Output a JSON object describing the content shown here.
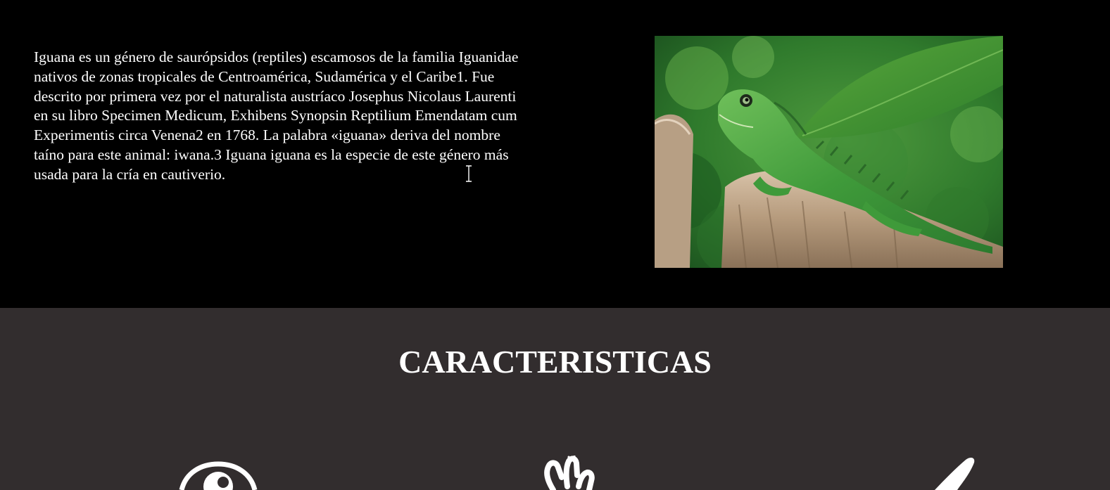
{
  "intro": {
    "paragraph": "Iguana es un género de saurópsidos (reptiles) escamosos de la familia Iguanidae nativos de zonas tropicales de Centroamérica, Sudamérica y el Caribe1. Fue descrito por primera vez por el naturalista austríaco Josephus Nicolaus Laurenti en su libro Specimen Medicum, Exhibens Synopsin Reptilium Emendatam cum Experimentis circa Venena2 en 1768. La palabra «iguana» deriva del nombre taíno para este animal: iwana.3 Iguana iguana es la especie de este género más usada para la cría en cautiverio.",
    "photo_subject": "green-iguana-on-tree-stump"
  },
  "features": {
    "title": "CARACTERISTICAS",
    "icons": [
      "eye-icon",
      "hand-icon",
      "claw-icon"
    ]
  },
  "colors": {
    "intro_background": "#000000",
    "features_background": "#322d2e",
    "text": "#ffffff"
  }
}
